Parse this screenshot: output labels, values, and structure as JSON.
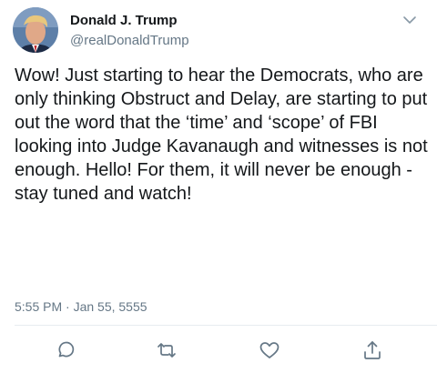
{
  "author": {
    "display_name": "Donald J. Trump",
    "username": "@realDonaldTrump",
    "avatar_icon": "profile-photo"
  },
  "tweet": {
    "text": "Wow! Just starting to hear the Democrats, who are only thinking Obstruct and Delay, are starting to put out the word that the ‘time’ and ‘scope’ of FBI looking into Judge Kavanaugh and witnesses is not enough. Hello! For them, it will never be enough - stay tuned and watch!",
    "timestamp": "5:55 PM · Jan 55, 5555"
  },
  "actions": [
    {
      "icon": "reply-icon"
    },
    {
      "icon": "retweet-icon"
    },
    {
      "icon": "like-icon"
    },
    {
      "icon": "share-icon"
    }
  ],
  "menu": {
    "icon": "chevron-down-icon"
  },
  "colors": {
    "text_primary": "#14171a",
    "text_secondary": "#657786",
    "icon": "#657786",
    "divider": "#e6ecf0",
    "background": "#ffffff"
  }
}
